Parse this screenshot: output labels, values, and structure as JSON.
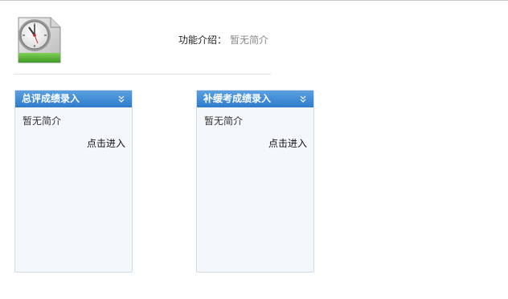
{
  "header": {
    "icon": "clock-icon",
    "intro_label": "功能介绍：",
    "intro_value": "暂无简介"
  },
  "panels": [
    {
      "title": "总评成绩录入",
      "description": "暂无简介",
      "link": "点击进入",
      "collapse_icon": "double-chevron-down-icon"
    },
    {
      "title": "补缓考成绩录入",
      "description": "暂无简介",
      "link": "点击进入",
      "collapse_icon": "double-chevron-down-icon"
    }
  ],
  "colors": {
    "panel_header_top": "#5aa0e0",
    "panel_header_bottom": "#2f7ccc",
    "panel_body": "#f4f8fc",
    "panel_border": "#cfdbe6"
  }
}
